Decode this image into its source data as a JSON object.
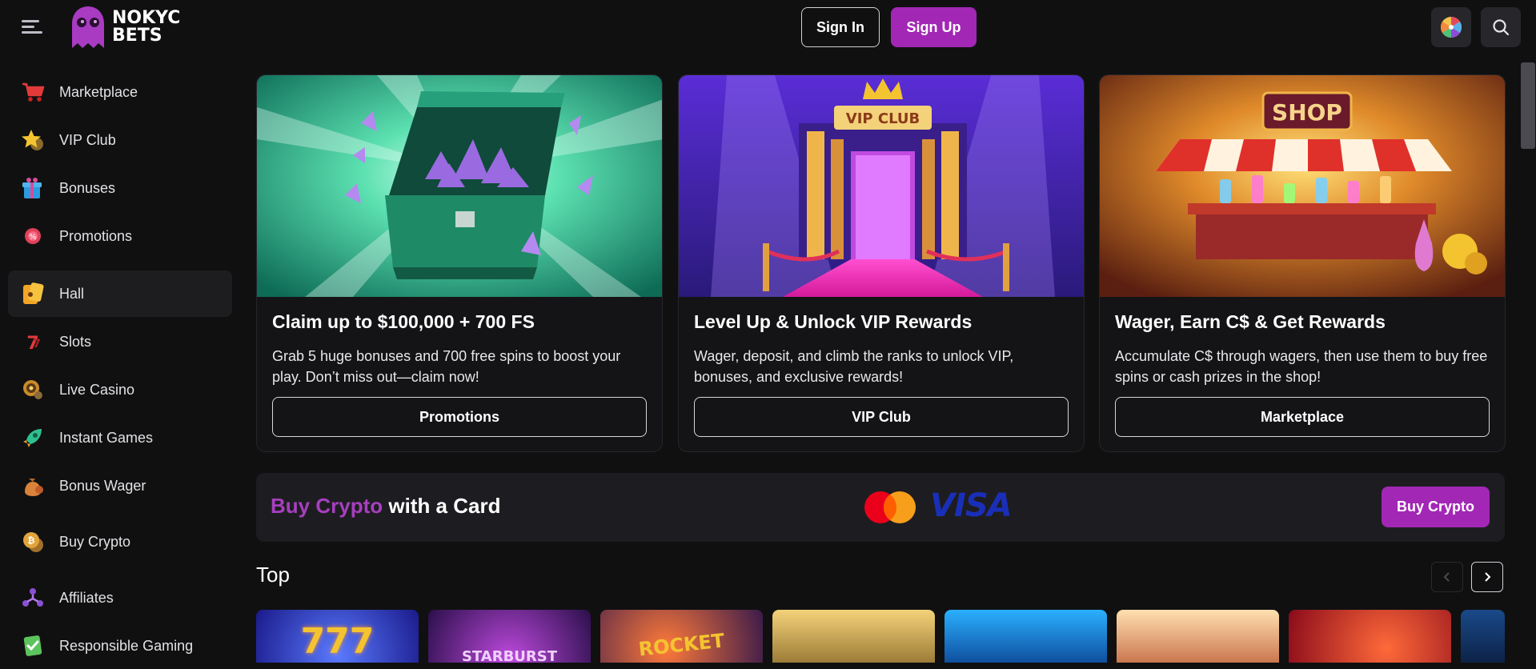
{
  "header": {
    "logo_line1": "NOKYC",
    "logo_line2": "BETS",
    "sign_in": "Sign In",
    "sign_up": "Sign Up",
    "icons": [
      "menu-icon",
      "wheel-icon",
      "search-icon"
    ]
  },
  "sidebar": {
    "items": [
      {
        "label": "Marketplace",
        "icon": "cart-icon"
      },
      {
        "label": "VIP Club",
        "icon": "star-icon"
      },
      {
        "label": "Bonuses",
        "icon": "gift-icon"
      },
      {
        "label": "Promotions",
        "icon": "promo-icon"
      },
      {
        "label": "Hall",
        "icon": "hall-icon",
        "active": true
      },
      {
        "label": "Slots",
        "icon": "slots-icon"
      },
      {
        "label": "Live Casino",
        "icon": "roulette-icon"
      },
      {
        "label": "Instant Games",
        "icon": "rocket-icon"
      },
      {
        "label": "Bonus Wager",
        "icon": "money-bag-icon"
      },
      {
        "label": "Buy Crypto",
        "icon": "coin-icon"
      },
      {
        "label": "Affiliates",
        "icon": "affiliates-icon"
      },
      {
        "label": "Responsible Gaming",
        "icon": "shield-check-icon"
      }
    ]
  },
  "promos": [
    {
      "title": "Claim up to $100,000 + 700 FS",
      "text": "Grab 5 huge bonuses and 700 free spins to boost your play. Don’t miss out—claim now!",
      "button": "Promotions"
    },
    {
      "title": "Level Up & Unlock VIP Rewards",
      "text": "Wager, deposit, and climb the ranks to unlock VIP, bonuses, and exclusive rewards!",
      "button": "VIP Club",
      "sign": "VIP CLUB"
    },
    {
      "title": "Wager, Earn C$ & Get Rewards",
      "text": "Accumulate C$ through wagers, then use them to buy free spins or cash prizes in the shop!",
      "button": "Marketplace",
      "sign": "SHOP"
    }
  ],
  "crypto_banner": {
    "accent": "Buy Crypto",
    "rest": " with a Card",
    "visa": "VISA",
    "button": "Buy Crypto"
  },
  "top_section": {
    "title": "Top",
    "games": [
      {
        "title": "777"
      },
      {
        "title": "STARBURST"
      },
      {
        "title": "ROCKET"
      },
      {
        "title": ""
      },
      {
        "title": ""
      },
      {
        "title": ""
      },
      {
        "title": ""
      }
    ]
  },
  "colors": {
    "accent": "#a227b5",
    "background": "#101011",
    "card": "#141416",
    "visa_blue": "#1a2fb8"
  }
}
